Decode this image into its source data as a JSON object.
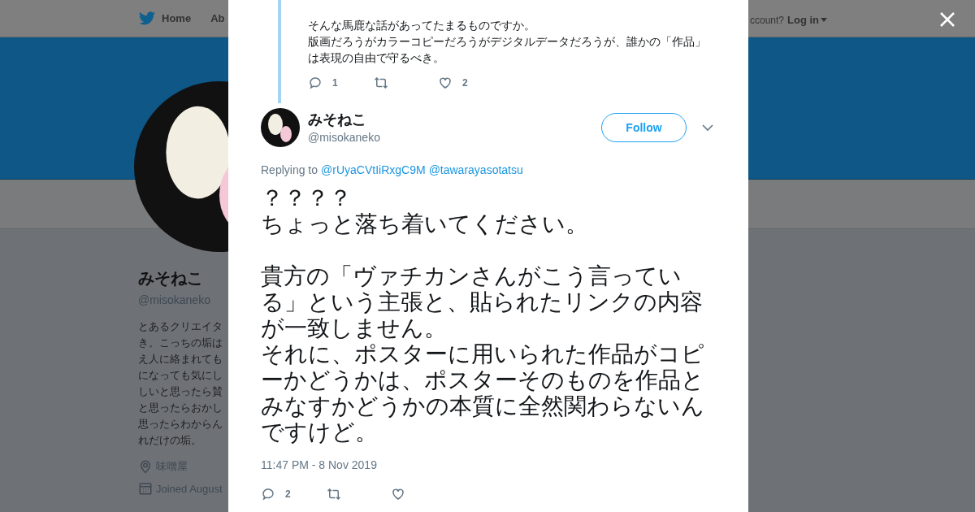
{
  "nav": {
    "home": "Home",
    "about": "Ab",
    "account": "ccount?",
    "login": "Log in"
  },
  "profile": {
    "name": "みそねこ",
    "handle": "@misokaneko",
    "bio_lines": [
      "とあるクリエイタ",
      "き。こっちの垢は",
      "え人に絡まれても",
      "になっても気にし",
      "しいと思ったら賛",
      "と思ったらおかし",
      "思ったらわからん",
      "れだけの垢。"
    ],
    "location": "味噌屋",
    "joined": "Joined August"
  },
  "quoted_tweet": {
    "lines": [
      "そんな馬鹿な話があってたまるものですか。",
      "版画だろうがカラーコピーだろうがデジタルデータだろうが、誰かの「作品」は表現の自由で守るべき。"
    ],
    "replies": "1",
    "likes": "2"
  },
  "tweet": {
    "name": "みそねこ",
    "handle": "@misokaneko",
    "follow": "Follow",
    "replying_label": "Replying to",
    "replying_to": [
      "@rUyaCVtIiRxgC9M",
      "@tawarayasotatsu"
    ],
    "paragraphs": [
      [
        "？？？？",
        "ちょっと落ち着いてください。"
      ],
      [
        "貴方の「ヴァチカンさんがこう言っている」という主張と、貼られたリンクの内容が一致しません。",
        "それに、ポスターに用いられた作品がコピーかどうかは、ポスターそのものを作品とみなすかどうかの本質に全然関わらないんですけど。"
      ]
    ],
    "time": "11:47 PM - 8 Nov 2019",
    "replies": "2"
  }
}
